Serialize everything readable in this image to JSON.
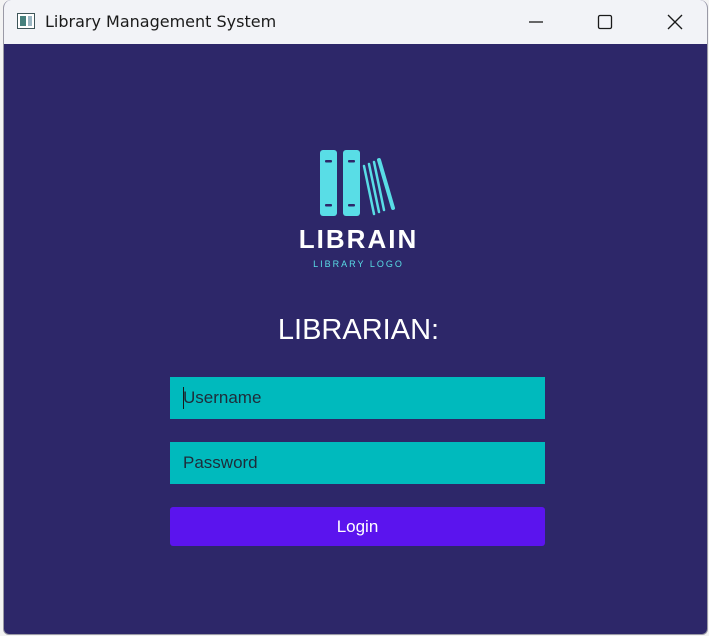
{
  "window": {
    "title": "Library Management System",
    "icon": "app-window-icon",
    "controls": [
      "minimize-icon",
      "maximize-icon",
      "close-icon"
    ]
  },
  "logo": {
    "name": "LIBRAIN",
    "tagline": "LIBRARY LOGO",
    "accent_color": "#59dde6"
  },
  "login": {
    "heading": "LIBRARIAN:",
    "username_placeholder": "Username",
    "password_placeholder": "Password",
    "button_label": "Login"
  },
  "colors": {
    "background": "#2d2769",
    "field": "#00babd",
    "button": "#5b14ee"
  }
}
